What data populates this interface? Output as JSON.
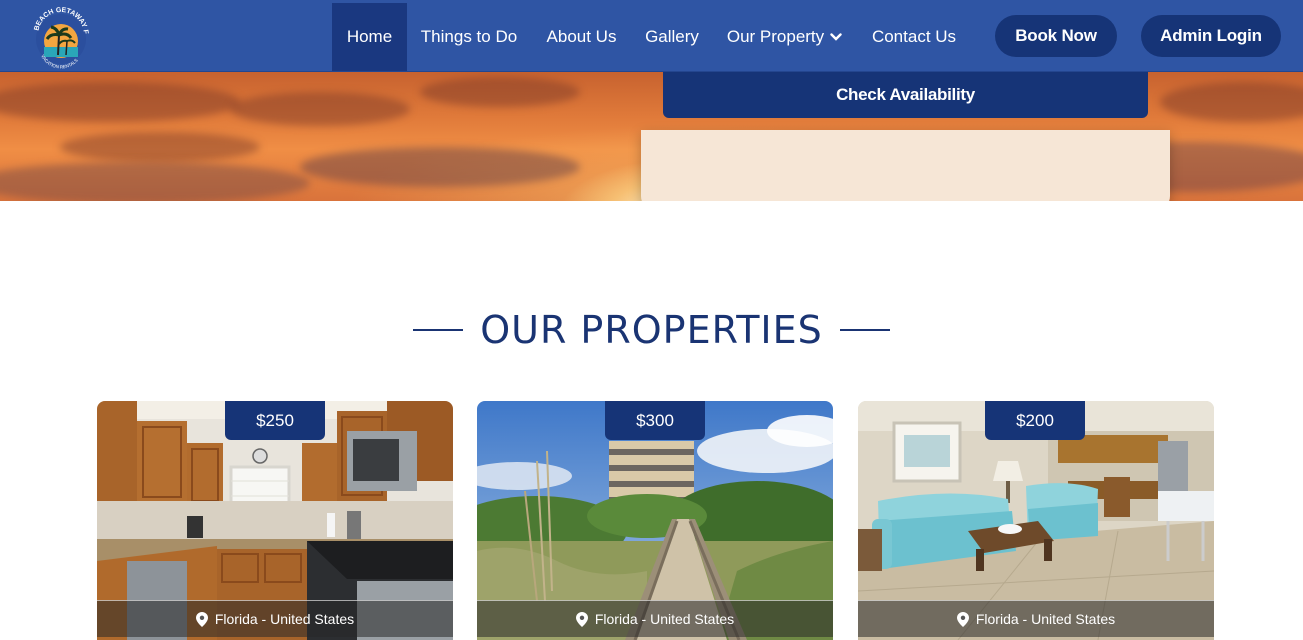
{
  "nav": {
    "logo_text": "BEACH GETAWAY FL",
    "logo_subtext": "VACATION RENTALS",
    "items": [
      {
        "label": "Home"
      },
      {
        "label": "Things to Do"
      },
      {
        "label": "About Us"
      },
      {
        "label": "Gallery"
      },
      {
        "label": "Our Property"
      },
      {
        "label": "Contact Us"
      }
    ],
    "book_now": "Book Now",
    "admin_login": "Admin Login"
  },
  "hero": {
    "check_availability": "Check Availability"
  },
  "section": {
    "title": "OUR PROPERTIES"
  },
  "properties": [
    {
      "price": "$250",
      "location": "Florida - United States",
      "image": "kitchen"
    },
    {
      "price": "$300",
      "location": "Florida - United States",
      "image": "beach-boardwalk"
    },
    {
      "price": "$200",
      "location": "Florida - United States",
      "image": "living-room"
    }
  ],
  "colors": {
    "nav_bg": "#2f55a4",
    "nav_active": "#1a3880",
    "brand_dark": "#163477",
    "heading": "#1a3473"
  }
}
